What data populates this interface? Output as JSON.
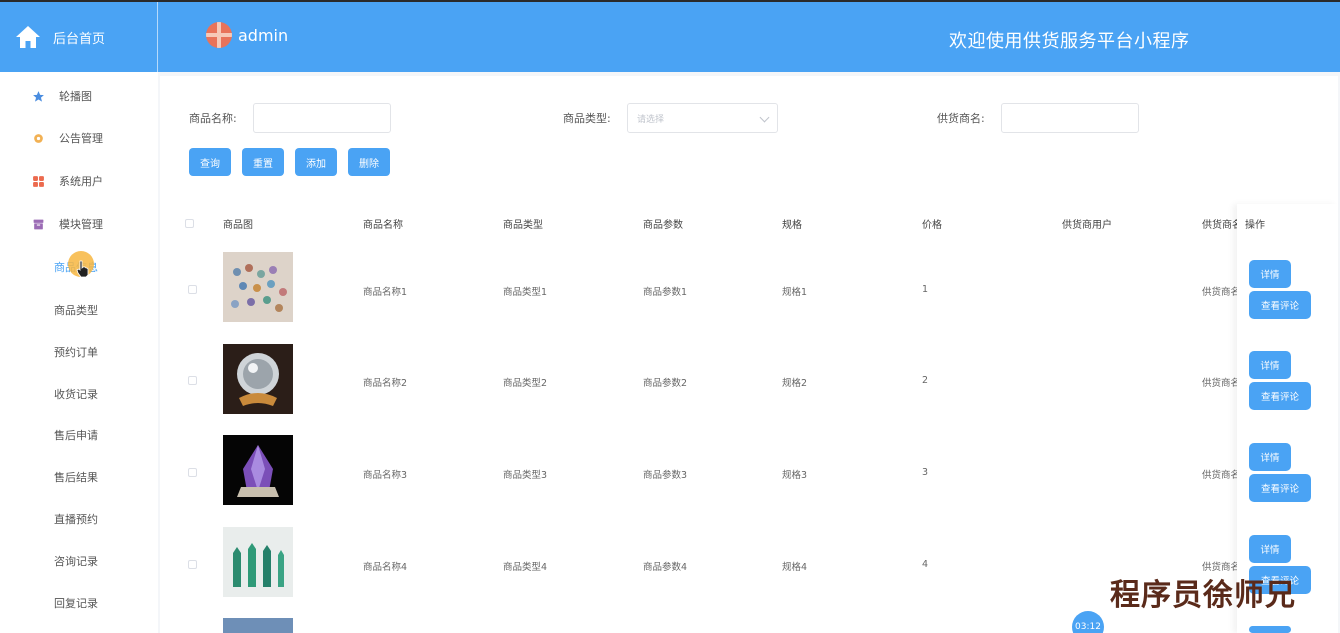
{
  "header": {
    "home_label": "后台首页",
    "user_name": "admin",
    "site_title": "欢迎使用供货服务平台小程序",
    "brand_color": "#4aa3f4"
  },
  "sidebar": {
    "menus": [
      {
        "label": "轮播图",
        "icon": "star-icon"
      },
      {
        "label": "公告管理",
        "icon": "gear-icon"
      },
      {
        "label": "系统用户",
        "icon": "grid-icon"
      },
      {
        "label": "模块管理",
        "icon": "box-icon"
      }
    ],
    "submenus": [
      {
        "label": "商品信息",
        "active": true
      },
      {
        "label": "商品类型"
      },
      {
        "label": "预约订单"
      },
      {
        "label": "收货记录"
      },
      {
        "label": "售后申请"
      },
      {
        "label": "售后结果"
      },
      {
        "label": "直播预约"
      },
      {
        "label": "咨询记录"
      },
      {
        "label": "回复记录"
      }
    ]
  },
  "filters": {
    "name_label": "商品名称:",
    "type_label": "商品类型:",
    "type_placeholder": "请选择",
    "supplier_label": "供货商名:"
  },
  "buttons": {
    "query": "查询",
    "reset": "重置",
    "add": "添加",
    "delete": "删除"
  },
  "table": {
    "headers": [
      "商品图",
      "商品名称",
      "商品类型",
      "商品参数",
      "规格",
      "价格",
      "供货商用户",
      "供货商名",
      "操作"
    ],
    "rows": [
      {
        "name": "商品名称1",
        "type": "商品类型1",
        "param": "商品参数1",
        "spec": "规格1",
        "price": "1",
        "supplier_user": "",
        "supplier_name": "供货商名"
      },
      {
        "name": "商品名称2",
        "type": "商品类型2",
        "param": "商品参数2",
        "spec": "规格2",
        "price": "2",
        "supplier_user": "",
        "supplier_name": "供货商名"
      },
      {
        "name": "商品名称3",
        "type": "商品类型3",
        "param": "商品参数3",
        "spec": "规格3",
        "price": "3",
        "supplier_user": "",
        "supplier_name": "供货商名"
      },
      {
        "name": "商品名称4",
        "type": "商品类型4",
        "param": "商品参数4",
        "spec": "规格4",
        "price": "4",
        "supplier_user": "",
        "supplier_name": "供货商名"
      }
    ],
    "detail_btn": "详情",
    "comment_btn": "查看评论"
  },
  "overlay": {
    "watermark": "程序员徐师兄",
    "timer": "03:12"
  }
}
